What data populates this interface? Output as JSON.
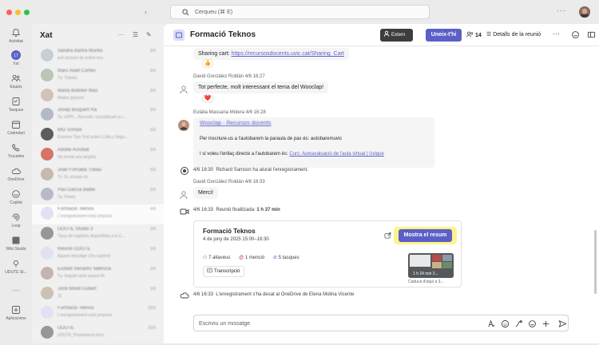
{
  "titlebar": {
    "search_placeholder": "Cerqueu (⌘ E)"
  },
  "rail": {
    "items": [
      {
        "label": "Activitat",
        "icon": "bell-icon"
      },
      {
        "label": "Xat",
        "icon": "chat-icon"
      },
      {
        "label": "Equips",
        "icon": "teams-icon"
      },
      {
        "label": "Tasques",
        "icon": "tasks-icon"
      },
      {
        "label": "Calendari",
        "icon": "calendar-icon"
      },
      {
        "label": "Trucades",
        "icon": "phone-icon"
      },
      {
        "label": "OneDrive",
        "icon": "cloud-icon"
      },
      {
        "label": "Copilot",
        "icon": "copilot-icon"
      },
      {
        "label": "Loop",
        "icon": "loop-icon"
      },
      {
        "label": "Wiki Studio",
        "icon": "wiki-icon"
      },
      {
        "label": "UDUTE St...",
        "icon": "app-icon"
      },
      {
        "label": "Aplicacions",
        "icon": "apps-icon"
      }
    ]
  },
  "chatlist": {
    "title": "Xat",
    "items": [
      {
        "name": "Sandra Bartra Murillo",
        "preview": "avit inclusie de ordret nou",
        "time": "6/6"
      },
      {
        "name": "Marc Aliart Cortès",
        "preview": "Tu: Thanks",
        "time": "6/6"
      },
      {
        "name": "Marta Boteller Mas",
        "preview": "Moltes gràcies!",
        "time": "6/6"
      },
      {
        "name": "Josep Bisquert Ra",
        "preview": "Tu: UPPI... Recordo i actualitzaré si c...",
        "time": "6/6"
      },
      {
        "name": "BIG School",
        "preview": "Examen Tipo Test sobre LLMs y Segu...",
        "time": "6/6"
      },
      {
        "name": "Adobe Acrobat",
        "preview": "Ha enviat una targeta",
        "time": "6/6"
      },
      {
        "name": "Joan Forcada Tubau",
        "preview": "Tu: Si, encara no",
        "time": "6/6"
      },
      {
        "name": "Pau García Batlle",
        "preview": "Tu: Power",
        "time": "6/6"
      },
      {
        "name": "Formació Teknos",
        "preview": "L'enregistrament està preparat",
        "time": "4/6"
      },
      {
        "name": "UDUTE Studio 3",
        "preview": "Tipus de registres disponibles a la C...",
        "time": "3/6"
      },
      {
        "name": "Reunió UDUTE",
        "preview": "Aquest missatge s'ha suprimit",
        "time": "3/6"
      },
      {
        "name": "Eudald Señarès Valencia",
        "preview": "Tu: Seguim amb aquest fil!",
        "time": "3/6"
      },
      {
        "name": "Jordi Molet Gullart",
        "preview": "😊",
        "time": "3/6"
      },
      {
        "name": "Formació Teknos",
        "preview": "L'enregistrament està preparat",
        "time": "29/5"
      },
      {
        "name": "UDUTE",
        "preview": "UDUTE_Presentacio.docx",
        "time": "29/5"
      }
    ]
  },
  "header": {
    "title": "Formació Teknos",
    "extern_label": "Extern",
    "join_label": "Uneix-t'hi",
    "people_count": "14",
    "details_label": "Detalls de la reunió"
  },
  "messages": {
    "m1": {
      "prefix": "Sharing cart: ",
      "link": "https://recursosdocents.uvic.cat/Sharing_Cart",
      "reaction": "👍"
    },
    "m2": {
      "meta": "David González Roldán  4/6 16:27",
      "text": "Tot perfecte, molt interessant el tema del Wooclap!",
      "reaction": "❤️"
    },
    "m3": {
      "meta": "Eulàlia Massana Molera  4/6 16:28",
      "link": "Wooclap - Recursos docents",
      "line2": "Per inscriure-us a l'autobarem la paraula de pas és: autobaremuvic",
      "line3_prefix": "I si voleu l'enllaç directe a l'autobarem és: ",
      "line3_link": "Curs: Autoavaluació de l'aula virtual | Uvique"
    },
    "sys1": {
      "time": "4/6 16:30",
      "text": "Richard Samson ha aturat l'enregistrament."
    },
    "m4": {
      "meta": "David González Roldán  4/6 16:33",
      "text": "Merci!"
    },
    "sys2": {
      "time": "4/6 16:33",
      "text": "Reunió finalitzada:",
      "duration": "1 h 37 min"
    },
    "sys3": {
      "time": "4/6 16:33",
      "text": "L'enregistrament s'ha desat al OneDrive de Elena Molina Vicente"
    }
  },
  "recap": {
    "title": "Formació Teknos",
    "date": "4 de juny de 2025 15:00–16:30",
    "show_label": "Mostra el resum",
    "stats": [
      "7 altaveus",
      "1 menció",
      "5 tasques"
    ],
    "transcript_label": "Transcripció",
    "thumb_duration": "1 h 24 min 2...",
    "expire_label": "Caduca d'aquí a 3..."
  },
  "composer": {
    "placeholder": "Escriviu un missatge"
  },
  "colors": {
    "accent": "#5b5fc7",
    "highlight": "#fff38a",
    "extern_bg": "#3d3d3d"
  }
}
